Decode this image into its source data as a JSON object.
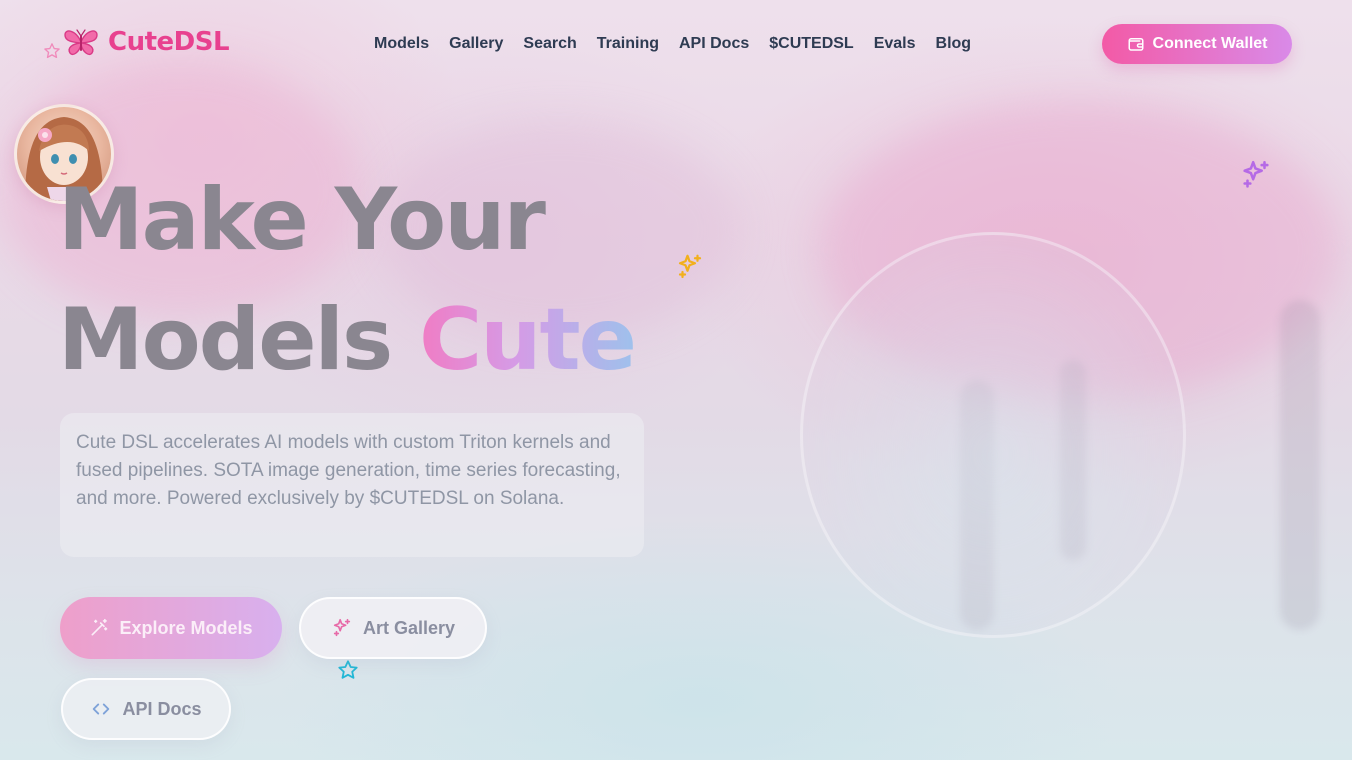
{
  "brand": {
    "name": "CuteDSL",
    "logo_icon": "butterfly-icon"
  },
  "nav": {
    "links": [
      "Models",
      "Gallery",
      "Search",
      "Training",
      "API Docs",
      "$CUTEDSL",
      "Evals",
      "Blog"
    ],
    "wallet_button": "Connect Wallet",
    "wallet_icon": "wallet-icon"
  },
  "hero": {
    "title_line1": "Make Your",
    "title_line2_plain": "Models",
    "title_line2_accent": "Cute",
    "description": "Cute DSL accelerates AI models with custom Triton kernels and fused pipelines. SOTA image generation, time series forecasting, and more. Powered exclusively by $CUTEDSL on Solana."
  },
  "actions": {
    "explore": {
      "label": "Explore Models",
      "icon": "magic-wand-icon"
    },
    "gallery": {
      "label": "Art Gallery",
      "icon": "sparkles-icon"
    },
    "api": {
      "label": "API Docs",
      "icon": "code-icon"
    }
  },
  "colors": {
    "brand_pink": "#e8418f",
    "nav_text": "#2e3b52",
    "wallet_gradient_start": "#f35aa6",
    "wallet_gradient_end": "#d98ae8",
    "sparkle_yellow": "#f4b41a",
    "sparkle_purple": "#b56ae6",
    "star_cyan": "#2bbfd8"
  }
}
